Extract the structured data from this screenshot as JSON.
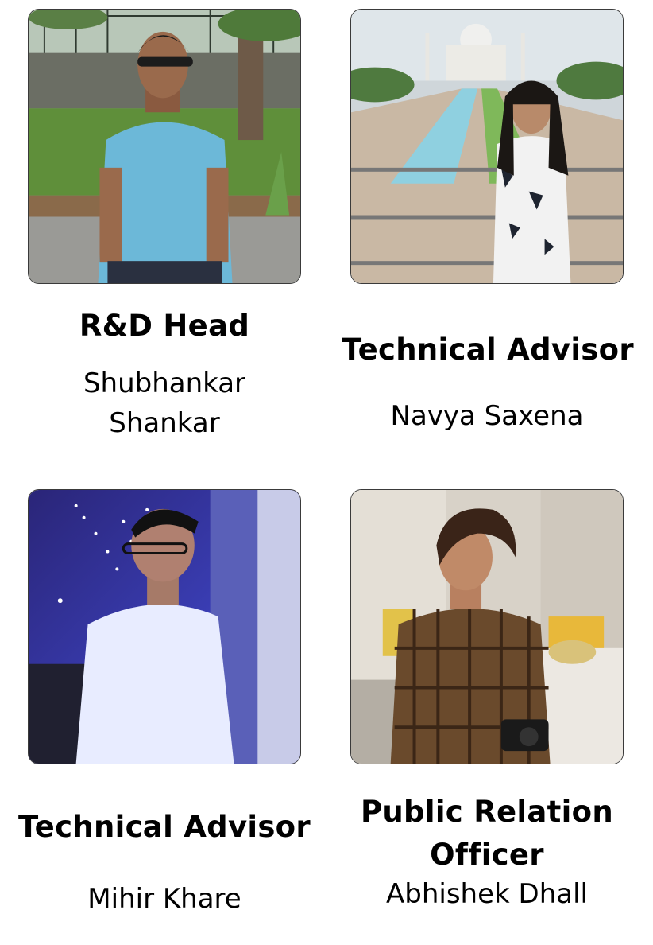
{
  "team": [
    {
      "role": "R&D Head",
      "name": "Shubhankar Shankar"
    },
    {
      "role": "Technical Advisor",
      "name": "Navya Saxena"
    },
    {
      "role": "Technical Advisor",
      "name": "Mihir Khare"
    },
    {
      "role": "Public Relation Officer",
      "name": "Abhishek Dhall"
    }
  ]
}
